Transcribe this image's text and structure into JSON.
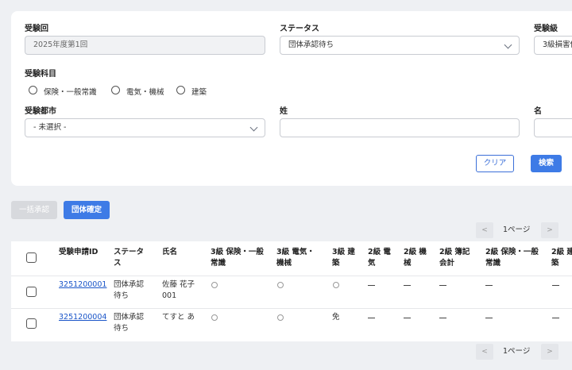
{
  "filters": {
    "exam_round": {
      "label": "受験回",
      "value": "2025年度第1回"
    },
    "status": {
      "label": "ステータス",
      "value": "団体承認待ち"
    },
    "exam_level": {
      "label": "受験級",
      "value": "3級損害保"
    },
    "subjects": {
      "label": "受験科目",
      "options": [
        "保険・一般常識",
        "電気・機械",
        "建築"
      ]
    },
    "city": {
      "label": "受験都市",
      "value": "- 未選択 -"
    },
    "last_name": {
      "label": "姓",
      "value": ""
    },
    "first_name": {
      "label": "名",
      "value": ""
    },
    "clear_label": "クリア",
    "search_label": "検索"
  },
  "actions": {
    "bulk_approve_label": "一括承認",
    "confirm_group_label": "団体確定"
  },
  "pagination": {
    "prev": "<",
    "next": ">",
    "page_text": "1ページ"
  },
  "table": {
    "headers": {
      "id": "受験申請ID",
      "status_l1": "ステータ",
      "status_l2": "ス",
      "name": "氏名",
      "l3_ins_l1": "3級 保険・一般",
      "l3_ins_l2": "常識",
      "l3_elec_l1": "3級 電気・",
      "l3_elec_l2": "機械",
      "l3_arch_l1": "3級 建",
      "l3_arch_l2": "築",
      "l2_elec_l1": "2級 電",
      "l2_elec_l2": "気",
      "l2_mach_l1": "2級 機",
      "l2_mach_l2": "械",
      "l2_book_l1": "2級 簿記",
      "l2_book_l2": "会計",
      "l2_ins_l1": "2級 保険・一般",
      "l2_ins_l2": "常識",
      "l2_arch_l1": "2級 建",
      "l2_arch_l2": "築"
    },
    "rows": [
      {
        "id": "3251200001",
        "status_l1": "団体承認",
        "status_l2": "待ち",
        "name_l1": "佐藤 花子",
        "name_l2": "001",
        "l3_arch": ""
      },
      {
        "id": "3251200004",
        "status_l1": "団体承認",
        "status_l2": "待ち",
        "name_l1": "てすと あ",
        "name_l2": "",
        "l3_arch": "免"
      }
    ]
  },
  "colors": {
    "accent": "#3e7be6",
    "link": "#1a55c8",
    "background": "#eef0f3"
  }
}
